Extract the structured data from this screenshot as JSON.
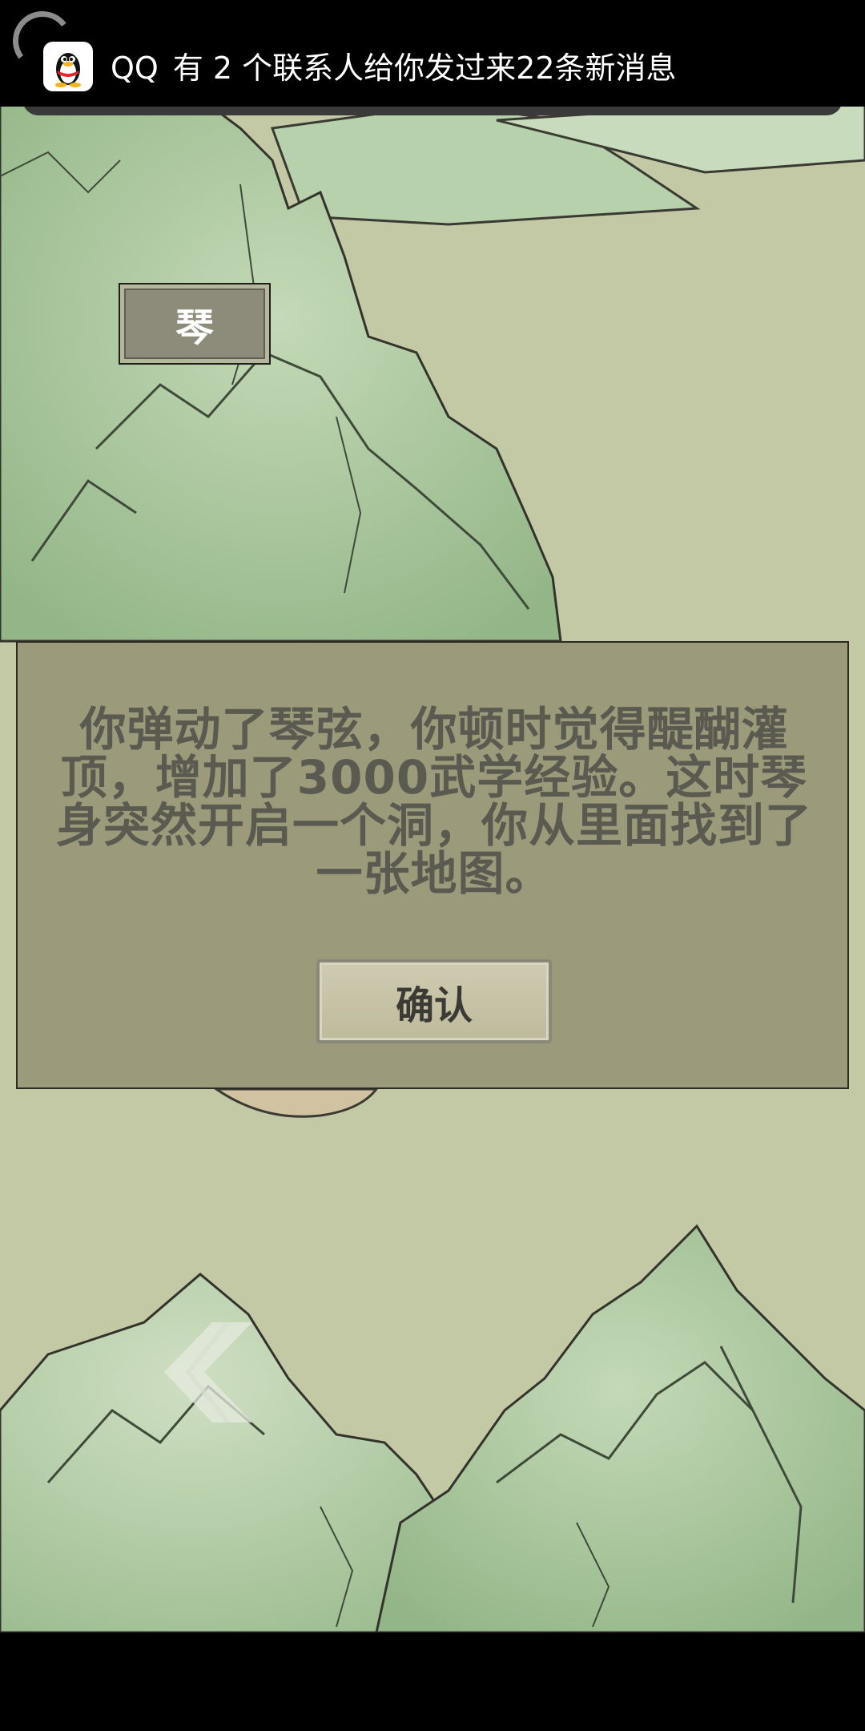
{
  "notification": {
    "app_name": "QQ",
    "message": "有 2 个联系人给你发过来22条新消息"
  },
  "scene": {
    "item_button_label": "琴"
  },
  "dialog": {
    "message": "你弹动了琴弦，你顿时觉得醍醐灌顶，增加了3000武学经验。这时琴身突然开启一个洞，你从里面找到了一张地图。",
    "confirm_label": "确认"
  },
  "colors": {
    "mountain": "#a6c49a",
    "parchment": "#c3c9a5",
    "dialog_bg": "#9b9a7a"
  }
}
